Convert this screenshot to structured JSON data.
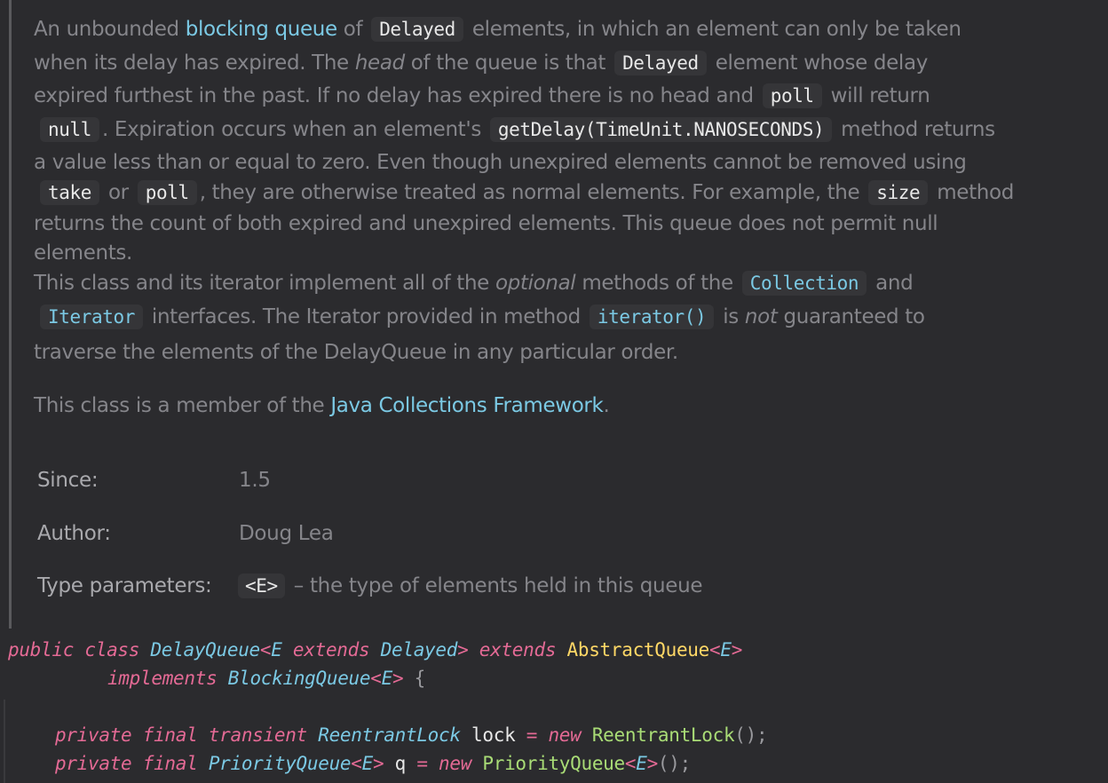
{
  "doc": {
    "p1": {
      "l1a": "An unbounded ",
      "l1link": "blocking queue",
      "l1b": " of ",
      "l1code": "Delayed",
      "l1c": " elements, in which an element can only be taken",
      "l2a": "when its delay has expired. The ",
      "l2em": "head",
      "l2b": " of the queue is that ",
      "l2code": "Delayed",
      "l2c": " element whose delay",
      "l3a": "expired furthest in the past. If no delay has expired there is no head and ",
      "l3code": "poll",
      "l3b": " will return",
      "l4code1": "null",
      "l4a": ". Expiration occurs when an element's ",
      "l4code2": "getDelay(TimeUnit.NANOSECONDS)",
      "l4b": " method returns",
      "l5": "a value less than or equal to zero. Even though unexpired elements cannot be removed using",
      "l6code1": "take",
      "l6a": " or ",
      "l6code2": "poll",
      "l6b": ", they are otherwise treated as normal elements. For example, the ",
      "l6code3": "size",
      "l6c": " method",
      "l7": "returns the count of both expired and unexpired elements. This queue does not permit null",
      "l8": "elements."
    },
    "p2": {
      "l1a": "This class and its iterator implement all of the ",
      "l1em": "optional",
      "l1b": " methods of the ",
      "l1code": "Collection",
      "l1c": " and",
      "l2code1": "Iterator",
      "l2a": " interfaces. The Iterator provided in method ",
      "l2code2": "iterator()",
      "l2b": " is ",
      "l2em": "not",
      "l2c": " guaranteed to",
      "l3": "traverse the elements of the DelayQueue in any particular order."
    },
    "p3": {
      "a": "This class is a member of the ",
      "link": "Java Collections Framework",
      "b": "."
    },
    "meta": {
      "since_label": "Since:",
      "since_value": "1.5",
      "author_label": "Author:",
      "author_value": "Doug Lea",
      "tp_label": "Type parameters:",
      "tp_code": "<E>",
      "tp_desc": " – the type of elements held in this queue"
    }
  },
  "code": {
    "line1": {
      "t1": "public class ",
      "t2": "DelayQueue",
      "t3": "<",
      "t4": "E",
      "t5": " extends ",
      "t6": "Delayed",
      "t7": ">",
      "t8": " extends ",
      "t9": "AbstractQueue",
      "t10": "<",
      "t11": "E",
      "t12": ">"
    },
    "line2": {
      "t1": "implements ",
      "t2": "BlockingQueue",
      "t3": "<",
      "t4": "E",
      "t5": ">",
      "t6": " {"
    },
    "line3": {
      "t1": "private final transient ",
      "t2": "ReentrantLock",
      "t3": " lock ",
      "t4": "=",
      "t5": " new ",
      "t6": "ReentrantLock",
      "t7": "();"
    },
    "line4": {
      "t1": "private final ",
      "t2": "PriorityQueue",
      "t3": "<",
      "t4": "E",
      "t5": ">",
      "t6": " q ",
      "t7": "=",
      "t8": " new ",
      "t9": "PriorityQueue",
      "t10": "<",
      "t11": "E",
      "t12": ">",
      "t13": "();"
    }
  }
}
